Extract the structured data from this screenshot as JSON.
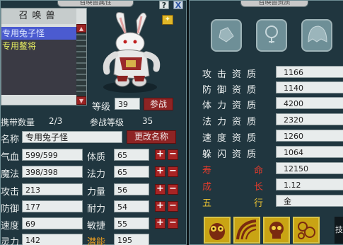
{
  "left_panel": {
    "title": "召唤兽属性",
    "help_label": "?",
    "close_label": "X",
    "list": {
      "header": "召唤兽",
      "items": [
        {
          "name": "专用兔子怪",
          "selected": true
        },
        {
          "name": "专用鳖将",
          "selected": false
        }
      ]
    },
    "level": {
      "label": "等级",
      "value": "39",
      "battle_button": "参战"
    },
    "carry": {
      "label": "携带数量",
      "value": "2/3"
    },
    "battle_level": {
      "label": "参战等级",
      "value": "35"
    },
    "name_row": {
      "label": "名称",
      "value": "专用兔子怪",
      "rename_button": "更改名称"
    },
    "stats": [
      {
        "label": "气血",
        "value": "599/599"
      },
      {
        "label": "魔法",
        "value": "398/398"
      },
      {
        "label": "攻击",
        "value": "213"
      },
      {
        "label": "防御",
        "value": "177"
      },
      {
        "label": "速度",
        "value": "69"
      },
      {
        "label": "灵力",
        "value": "142"
      }
    ],
    "attributes": [
      {
        "label": "体质",
        "value": "65"
      },
      {
        "label": "法力",
        "value": "65"
      },
      {
        "label": "力量",
        "value": "56"
      },
      {
        "label": "耐力",
        "value": "54"
      },
      {
        "label": "敏捷",
        "value": "55"
      }
    ],
    "potential": {
      "label": "潜能",
      "value": "195"
    },
    "plus": "+",
    "minus": "−"
  },
  "right_panel": {
    "title": "召唤兽资质",
    "tabs": [
      {
        "icon": "armor-icon"
      },
      {
        "icon": "necklace-icon"
      },
      {
        "icon": "helmet-icon"
      }
    ],
    "aptitudes": [
      {
        "label": "攻击资质",
        "value": "1166",
        "color": "white"
      },
      {
        "label": "防御资质",
        "value": "1140",
        "color": "white"
      },
      {
        "label": "体力资质",
        "value": "4200",
        "color": "white"
      },
      {
        "label": "法力资质",
        "value": "2320",
        "color": "white"
      },
      {
        "label": "速度资质",
        "value": "1260",
        "color": "white"
      },
      {
        "label": "躲闪资质",
        "value": "1064",
        "color": "white"
      },
      {
        "label": "寿命",
        "value": "12150",
        "color": "red"
      },
      {
        "label": "成长",
        "value": "1.12",
        "color": "red"
      },
      {
        "label": "五行",
        "value": "金",
        "color": "gold"
      }
    ],
    "skills": [
      {
        "icon": "owl-skill-icon"
      },
      {
        "icon": "arc-skill-icon"
      },
      {
        "icon": "skull-skill-icon"
      },
      {
        "icon": "bubble-skill-icon"
      }
    ],
    "side_char": "技"
  }
}
